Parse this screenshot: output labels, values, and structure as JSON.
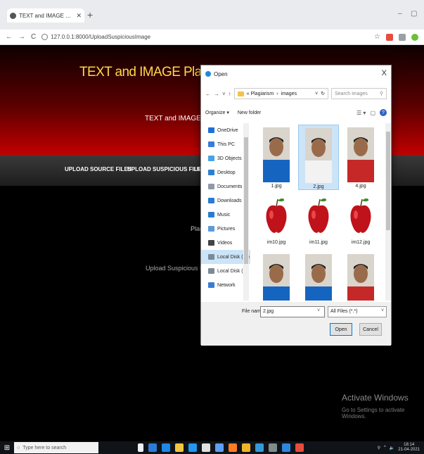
{
  "browser": {
    "tab_title": "TEXT and IMAGE Plagiarism Dete",
    "new_tab": "+",
    "url": "127.0.0.1:8000/UploadSuspiciousImage",
    "minimize": "–",
    "restore": "▢"
  },
  "site": {
    "title": "TEXT and IMAGE Plagiarism Detec",
    "subtitle": "TEXT and IMAGE Plagi",
    "nav": [
      "UPLOAD SOURCE FILES",
      "UPLOAD SUSPICIOUS FILE",
      "UP"
    ],
    "heading": "Plagi",
    "upload_label": "Upload Suspicious File"
  },
  "dialog": {
    "title": "Open",
    "close": "X",
    "path": [
      "« Plagiarism",
      "images"
    ],
    "search_placeholder": "Search images",
    "organize": "Organize ▾",
    "new_folder": "New folder",
    "nav_items": [
      {
        "label": "OneDrive",
        "color": "#1e6fd9"
      },
      {
        "label": "This PC",
        "color": "#3a7bd5"
      },
      {
        "label": "3D Objects",
        "color": "#4aa3df"
      },
      {
        "label": "Desktop",
        "color": "#2f80d1"
      },
      {
        "label": "Documents",
        "color": "#8e9aa6"
      },
      {
        "label": "Downloads",
        "color": "#2b7ad0"
      },
      {
        "label": "Music",
        "color": "#2b7ad0"
      },
      {
        "label": "Pictures",
        "color": "#5c9bd6"
      },
      {
        "label": "Videos",
        "color": "#444444"
      },
      {
        "label": "Local Disk (C:)",
        "color": "#7c8a96"
      },
      {
        "label": "Local Disk (E:)",
        "color": "#7c8a96"
      },
      {
        "label": "Network",
        "color": "#3a7bd5"
      }
    ],
    "files": [
      {
        "name": "1.jpg",
        "kind": "portrait-blue"
      },
      {
        "name": "2.jpg",
        "kind": "portrait-white",
        "selected": true
      },
      {
        "name": "4.jpg",
        "kind": "portrait-red"
      },
      {
        "name": "im10.jpg",
        "kind": "apple"
      },
      {
        "name": "im11.jpg",
        "kind": "apple"
      },
      {
        "name": "im12.jpg",
        "kind": "apple"
      },
      {
        "name": "",
        "kind": "partial"
      },
      {
        "name": "",
        "kind": "partial"
      },
      {
        "name": "",
        "kind": "partial-red"
      }
    ],
    "file_name_label": "File name:",
    "file_name_value": "2.jpg",
    "file_type": "All Files (*.*)",
    "open_button": "Open",
    "cancel_button": "Cancel"
  },
  "watermark": {
    "title": "Activate Windows",
    "subtitle": "Go to Settings to activate Windows."
  },
  "taskbar": {
    "search_placeholder": "Type here to search",
    "time": "18:14",
    "date": "21-04-2021"
  },
  "colors": {
    "header_gold": "#ffd94a",
    "header_red": "#c10000",
    "selection": "#cce4f7"
  }
}
